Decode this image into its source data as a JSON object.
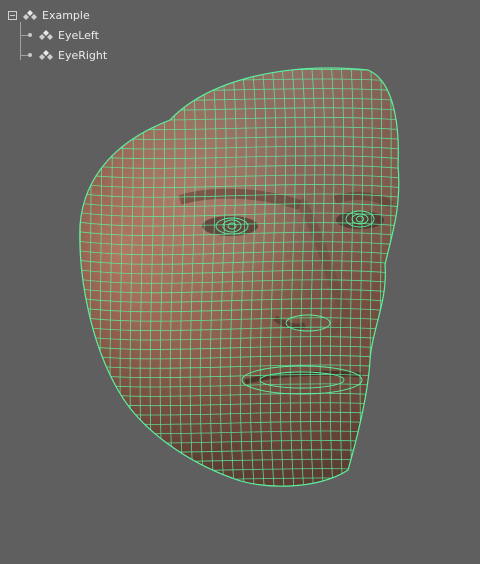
{
  "outliner": {
    "items": [
      {
        "label": "Example",
        "expanded": true
      },
      {
        "label": "EyeLeft"
      },
      {
        "label": "EyeRight"
      }
    ]
  },
  "viewport": {
    "background": "#5f5f5f",
    "wireframe_color": "#5cf0a0",
    "skin_color": "#b57a63"
  }
}
